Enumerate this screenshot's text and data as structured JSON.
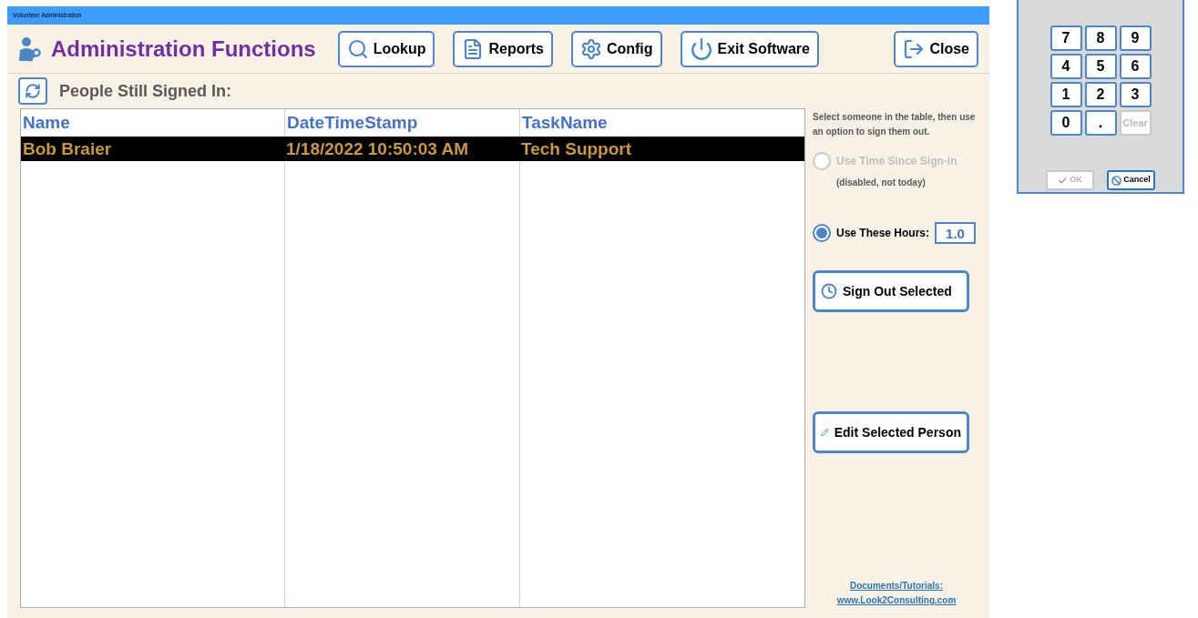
{
  "window": {
    "title": "Volunteer Administration"
  },
  "header": {
    "title": "Administration Functions"
  },
  "toolbar": [
    {
      "label": "Lookup",
      "kind": "lookup"
    },
    {
      "label": "Reports",
      "kind": "reports"
    },
    {
      "label": "Config",
      "kind": "config"
    },
    {
      "label": "Exit Software",
      "kind": "exit"
    },
    {
      "label": "Close",
      "kind": "close"
    }
  ],
  "section_title": "People Still Signed In:",
  "table": {
    "columns": [
      "Name",
      "DateTimeStamp",
      "TaskName"
    ],
    "rows": [
      {
        "cells": [
          "Bob Braier",
          "1/18/2022 10:50:03 AM",
          "Tech Support"
        ],
        "selected": true
      }
    ]
  },
  "instructions": "Select someone in the table, then use an option to sign them out.",
  "options": [
    {
      "label": "Use Time Since Sign-in",
      "selected": false,
      "disabled": true,
      "note": "(disabled, not today)"
    },
    {
      "label": "Use These Hours:",
      "selected": true,
      "disabled": false,
      "value": "1.0"
    }
  ],
  "actions": [
    {
      "label": "Sign Out Selected",
      "kind": "sign-out"
    },
    {
      "label": "Edit Selected Person",
      "kind": "edit"
    }
  ],
  "links": [
    "Documents/Tutorials:",
    "www.Look2Consulting.com"
  ],
  "keypad": {
    "keys": [
      {
        "label": "7",
        "disabled": false
      },
      {
        "label": "8",
        "disabled": false
      },
      {
        "label": "9",
        "disabled": false
      },
      {
        "label": "4",
        "disabled": false
      },
      {
        "label": "5",
        "disabled": false
      },
      {
        "label": "6",
        "disabled": false
      },
      {
        "label": "1",
        "disabled": false
      },
      {
        "label": "2",
        "disabled": false
      },
      {
        "label": "3",
        "disabled": false
      },
      {
        "label": "0",
        "disabled": false
      },
      {
        "label": ".",
        "disabled": false
      },
      {
        "label": "Clear",
        "disabled": true
      }
    ],
    "buttons": [
      {
        "label": "OK",
        "kind": "ok",
        "disabled": true
      },
      {
        "label": "Cancel",
        "kind": "cancel",
        "disabled": false
      }
    ]
  }
}
